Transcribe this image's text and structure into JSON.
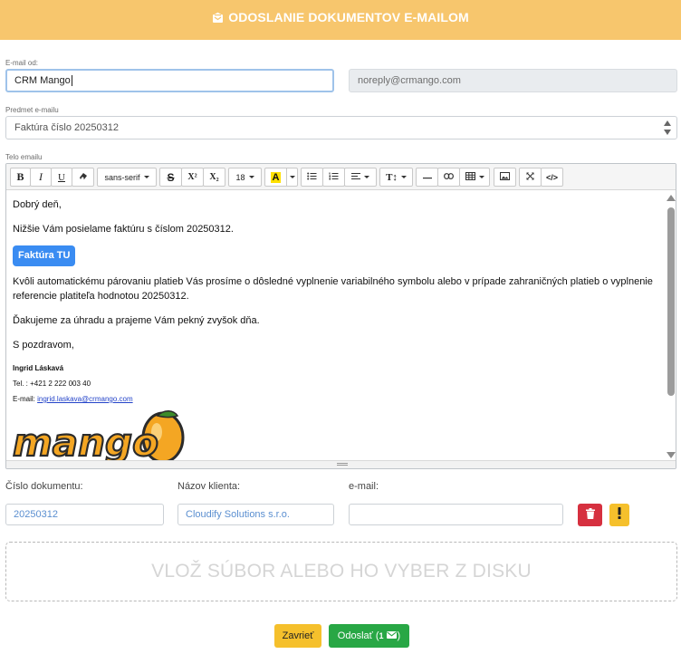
{
  "header": {
    "title": "ODOSLANIE DOKUMENTOV E-MAILOM",
    "icon": "envelope-open-icon"
  },
  "email_from": {
    "label": "E-mail od:",
    "name_value": "CRM Mango",
    "address_value": "noreply@crmango.com"
  },
  "subject": {
    "label": "Predmet e-mailu",
    "value": "Faktúra číslo 20250312"
  },
  "body": {
    "label": "Telo emailu",
    "toolbar": {
      "bold": "B",
      "italic": "I",
      "underline": "U",
      "eraser_icon": "eraser-icon",
      "font_family": "sans-serif",
      "strikethrough": "S",
      "superscript": "X²",
      "subscript": "X₂",
      "font_size": "18",
      "color_letter": "A",
      "line_height": "T↕"
    },
    "greeting": "Dobrý deň,",
    "line1": "Nižšie Vám posielame faktúru s číslom 20250312.",
    "invoice_button": "Faktúra TU",
    "line2": "Kvôli automatickému párovaniu platieb Vás prosíme o dôsledné vyplnenie variabilného symbolu alebo v prípade zahraničných platieb o vyplnenie referencie platiteľa hodnotou 20250312.",
    "line3": "Ďakujeme za úhradu a prajeme Vám pekný zvyšok dňa.",
    "closing": "S pozdravom,",
    "signature": {
      "name": "Ingrid Láskavá",
      "phone": "Tel. : +421 2 222 003 40",
      "email_prefix": "E-mail: ",
      "email": "ingrid.laskava@crmango.com"
    },
    "logo_text": "mango"
  },
  "fields": {
    "doc_number_label": "Číslo dokumentu:",
    "doc_number_value": "20250312",
    "client_label": "Názov klienta:",
    "client_value": "Cloudify Solutions s.r.o.",
    "email_label": "e-mail:",
    "email_value": ""
  },
  "dropzone": {
    "text": "VLOŽ SÚBOR ALEBO HO VYBER Z DISKU"
  },
  "footer": {
    "close_label": "Zavrieť",
    "send_label": "Odoslať (",
    "send_count": "1",
    "send_suffix": ")"
  },
  "colors": {
    "header": "#f7c66d",
    "invoice_button": "#3a8cf2",
    "delete": "#d6303f",
    "warning": "#f5c02c",
    "send": "#28a745",
    "close": "#f5c02c"
  }
}
